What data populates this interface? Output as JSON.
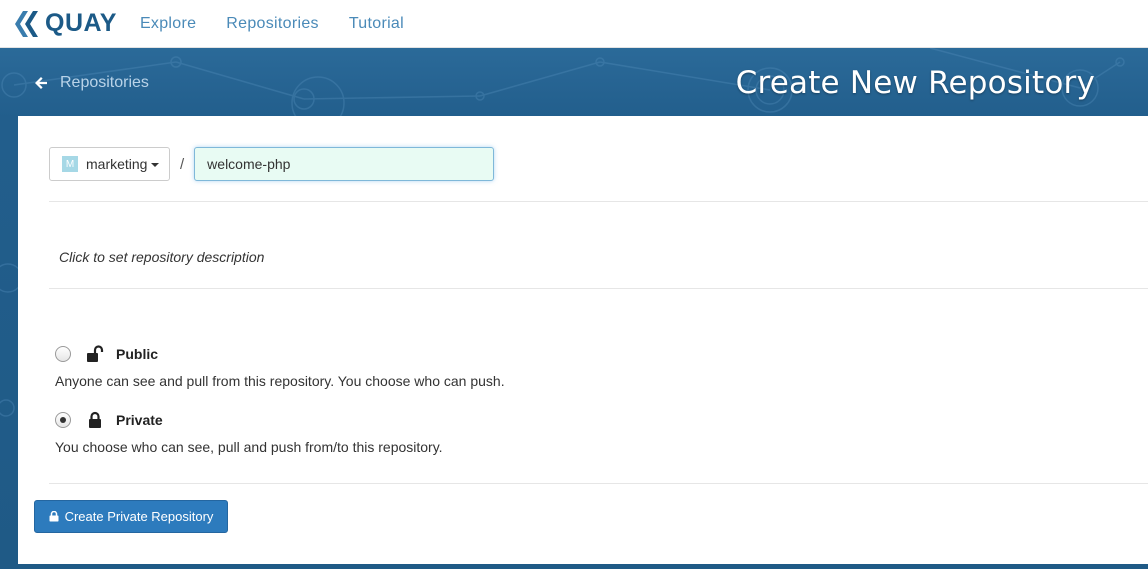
{
  "navbar": {
    "brand": "QUAY",
    "links": [
      "Explore",
      "Repositories",
      "Tutorial"
    ]
  },
  "header": {
    "back_label": "Repositories",
    "title": "Create New Repository"
  },
  "form": {
    "namespace": {
      "avatar_letter": "M",
      "name": "marketing"
    },
    "separator": "/",
    "repo_name": "welcome-php",
    "description_placeholder": "Click to set repository description",
    "visibility": {
      "public": {
        "label": "Public",
        "description": "Anyone can see and pull from this repository. You choose who can push.",
        "selected": false
      },
      "private": {
        "label": "Private",
        "description": "You choose who can see, pull and push from/to this repository.",
        "selected": true
      }
    },
    "submit_label": "Create Private Repository"
  },
  "colors": {
    "brand": "#1c5a87",
    "header_bg": "#1f5a86",
    "button": "#2d7bbd",
    "input_bg": "#e8fbf3"
  }
}
